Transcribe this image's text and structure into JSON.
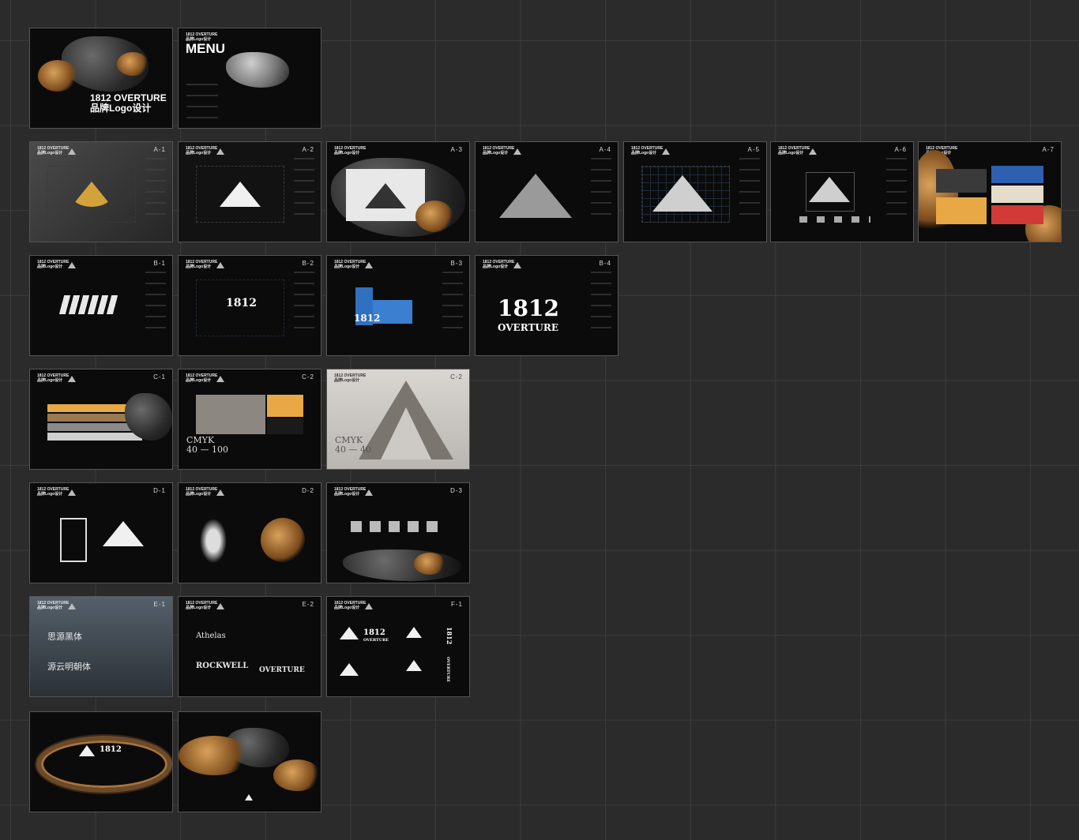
{
  "board_codes": {
    "a1": "A-1",
    "a2": "A-2",
    "a3": "A-3",
    "a4": "A-4",
    "a5": "A-5",
    "a6": "A-6",
    "a7": "A-7",
    "b1": "B-1",
    "b2": "B-2",
    "b3": "B-3",
    "b4": "B-4",
    "c1": "C-1",
    "c2": "C-2",
    "c3": "C-2",
    "d1": "D-1",
    "d2": "D-2",
    "d3": "D-3",
    "e1": "E-1",
    "e2": "E-2",
    "f1": "F-1"
  },
  "header": "1812 OVERTURE\n品牌Logo设计",
  "cover": {
    "title_line1": "1812 OVERTURE",
    "title_line2": "品牌Logo设计"
  },
  "menu": {
    "title": "MENU"
  },
  "wordmarks": {
    "b2": "1812",
    "b3": "1812",
    "b4_line1": "1812",
    "b4_line2": "OVERTURE",
    "last": "1812"
  },
  "cmyk": {
    "c2_line1": "CMYK",
    "c2_line2": "40 — 100",
    "c3_line1": "CMYK",
    "c3_line2": "40 — 40"
  },
  "fonts": {
    "e1_a": "思源黑体",
    "e1_b": "源云明朝体",
    "e2_a": "Athelas",
    "e2_b": "ROCKWELL",
    "e2_c": "OVERTURE"
  },
  "f1": {
    "wm1": "1812",
    "wm2": "OVERTURE",
    "wm3": "1812",
    "wm4": "OVERTURE"
  },
  "colors": {
    "background": "#2b2b2b",
    "gold": "#d4a23a",
    "blue": "#2f5fb0",
    "red": "#d13a36",
    "beige": "#e6dccb",
    "orange": "#e8a845"
  }
}
